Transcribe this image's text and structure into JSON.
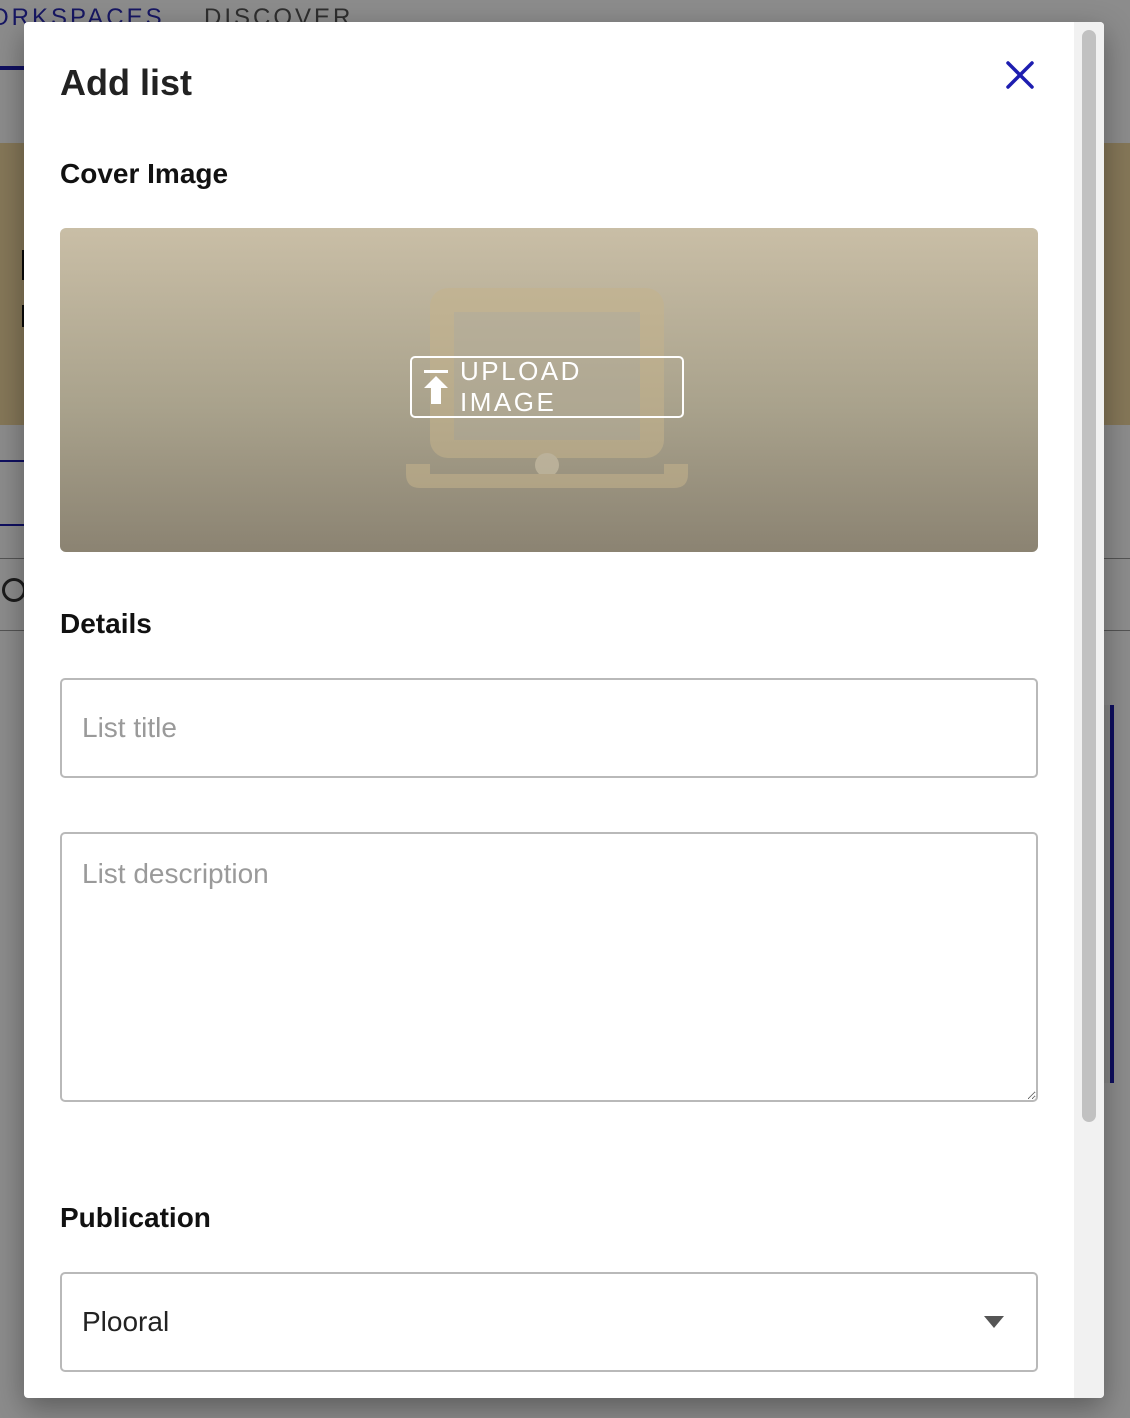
{
  "background": {
    "nav_tabs": [
      "ORKSPACES",
      "DISCOVER"
    ]
  },
  "modal": {
    "title": "Add list",
    "close_icon": "close-icon",
    "cover": {
      "heading": "Cover Image",
      "placeholder_icon": "laptop-icon",
      "upload_label": "UPLOAD IMAGE",
      "upload_icon": "upload-icon"
    },
    "details": {
      "heading": "Details",
      "title_placeholder": "List title",
      "description_placeholder": "List description"
    },
    "publication": {
      "heading": "Publication",
      "selected": "Plooral",
      "caret_icon": "chevron-down-icon"
    }
  },
  "colors": {
    "accent": "#1d1db0",
    "cover_gradient_top": "#c9bea6",
    "cover_gradient_bottom": "#8b8372",
    "field_border": "#b9b9b9"
  }
}
